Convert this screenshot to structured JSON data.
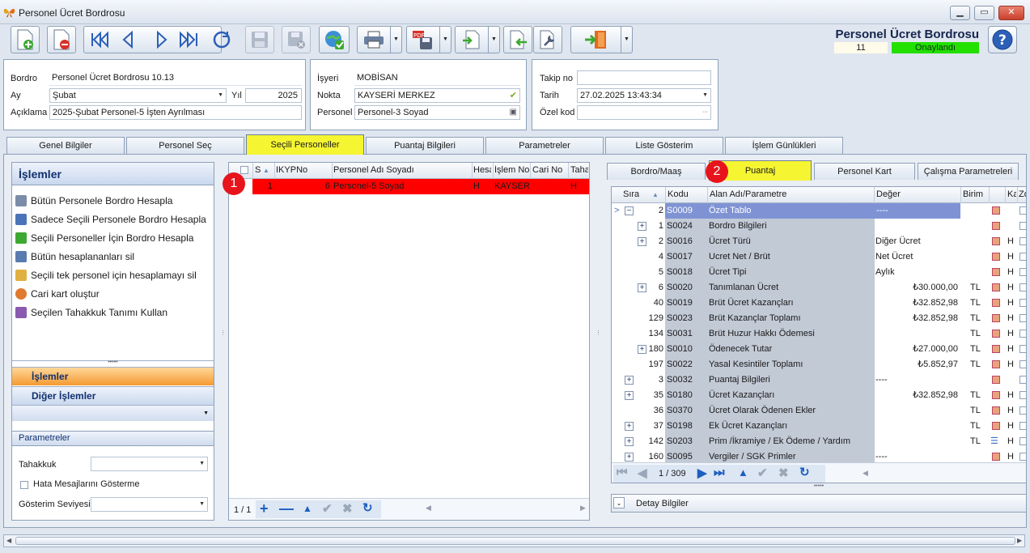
{
  "window": {
    "title": "Personel Ücret Bordrosu"
  },
  "header": {
    "doc_title": "Personel Ücret Bordrosu",
    "doc_no": "11",
    "status": "Onaylandı",
    "status_color": "#22e000"
  },
  "form": {
    "bordro_label": "Bordro",
    "bordro_value": "Personel Ücret Bordrosu 10.13",
    "ay_label": "Ay",
    "ay_value": "Şubat",
    "yil_label": "Yıl",
    "yil_value": "2025",
    "aciklama_label": "Açıklama",
    "aciklama_value": "2025-Şubat Personel-5 İşten Ayrılması",
    "isyeri_label": "İşyeri",
    "isyeri_value": "MOBİSAN",
    "nokta_label": "Nokta",
    "nokta_value": "KAYSERİ MERKEZ",
    "personel_label": "Personel",
    "personel_value": "Personel-3 Soyad",
    "takip_label": "Takip no",
    "takip_value": "",
    "tarih_label": "Tarih",
    "tarih_value": "27.02.2025 13:43:34",
    "ozel_label": "Özel kod",
    "ozel_value": "",
    "ellipsis": "···"
  },
  "tabs": [
    "Genel Bilgiler",
    "Personel Seç",
    "Seçili Personeller",
    "Puantaj Bilgileri",
    "Parametreler",
    "Liste Gösterim",
    "İşlem Günlükleri"
  ],
  "left": {
    "title": "İşlemler",
    "ops": [
      "Bütün Personele Bordro Hesapla",
      "Sadece Seçili Personele Bordro Hesapla",
      "Seçili Personeller İçin Bordro Hesapla",
      "Bütün hesaplananları sil",
      "Seçili tek personel için hesaplamayı sil",
      "Cari kart oluştur",
      "Seçilen Tahakkuk Tanımı Kullan"
    ],
    "nav_active": "İşlemler",
    "nav_other": "Diğer İşlemler",
    "params_title": "Parametreler",
    "tahakkuk_label": "Tahakkuk",
    "hata_label": "Hata Mesajlarını Gösterme",
    "seviye_label": "Gösterim Seviyesi"
  },
  "mid": {
    "columns": [
      "S",
      "IKYPNo",
      "Personel Adı Soyadı",
      "Hesa",
      "İşlem No",
      "Cari No",
      "Taha"
    ],
    "row": {
      "s": "1",
      "ikyp": "6",
      "name": "Personel-5 Soyad",
      "hesa": "H",
      "islem": "KAYSERİ",
      "cari": "",
      "taha": "H"
    },
    "row_color": "#ff0000",
    "pager": "1 / 1",
    "badge": "1"
  },
  "right": {
    "subtabs": [
      "Bordro/Maaş",
      "Puantaj",
      "Personel Kart",
      "Çalışma Parametreleri"
    ],
    "badge": "2",
    "columns": [
      "Sıra",
      "Kodu",
      "Alan Adı/Parametre",
      "Değer",
      "Birim",
      "Ka",
      "Zo"
    ],
    "rows": [
      {
        "sira": "2",
        "kod": "S0009",
        "ad": "Özet Tablo",
        "deger": "----",
        "birim": "",
        "h": "",
        "tree": "minus",
        "indent": 0
      },
      {
        "sira": "1",
        "kod": "S0024",
        "ad": "Bordro Bilgileri",
        "deger": "",
        "birim": "",
        "h": "",
        "tree": "plus",
        "indent": 1
      },
      {
        "sira": "2",
        "kod": "S0016",
        "ad": "Ücret Türü",
        "deger": "Diğer Ücret",
        "birim": "",
        "h": "H",
        "tree": "plus",
        "indent": 1
      },
      {
        "sira": "4",
        "kod": "S0017",
        "ad": "Ucret Net / Brüt",
        "deger": "Net Ücret",
        "birim": "",
        "h": "H",
        "tree": "",
        "indent": 1
      },
      {
        "sira": "5",
        "kod": "S0018",
        "ad": "Ücret Tipi",
        "deger": "Aylık",
        "birim": "",
        "h": "H",
        "tree": "",
        "indent": 1
      },
      {
        "sira": "6",
        "kod": "S0020",
        "ad": "Tanımlanan Ücret",
        "deger": "₺30.000,00",
        "birim": "TL",
        "h": "H",
        "tree": "plus",
        "indent": 1
      },
      {
        "sira": "40",
        "kod": "S0019",
        "ad": "Brüt Ücret Kazançları",
        "deger": "₺32.852,98",
        "birim": "TL",
        "h": "H",
        "tree": "",
        "indent": 1
      },
      {
        "sira": "129",
        "kod": "S0023",
        "ad": "Brüt Kazançlar Toplamı",
        "deger": "₺32.852,98",
        "birim": "TL",
        "h": "H",
        "tree": "",
        "indent": 1
      },
      {
        "sira": "134",
        "kod": "S0031",
        "ad": "Brüt Huzur Hakkı Ödemesi",
        "deger": "",
        "birim": "TL",
        "h": "H",
        "tree": "",
        "indent": 1
      },
      {
        "sira": "180",
        "kod": "S0010",
        "ad": "Ödenecek Tutar",
        "deger": "₺27.000,00",
        "birim": "TL",
        "h": "H",
        "tree": "plus",
        "indent": 1
      },
      {
        "sira": "197",
        "kod": "S0022",
        "ad": "Yasal Kesintiler Toplamı",
        "deger": "₺5.852,97",
        "birim": "TL",
        "h": "H",
        "tree": "",
        "indent": 1
      },
      {
        "sira": "3",
        "kod": "S0032",
        "ad": "Puantaj Bilgileri",
        "deger": "----",
        "birim": "",
        "h": "",
        "tree": "plus",
        "indent": 0
      },
      {
        "sira": "35",
        "kod": "S0180",
        "ad": "Ücret Kazançları",
        "deger": "₺32.852,98",
        "birim": "TL",
        "h": "H",
        "tree": "plus",
        "indent": 0
      },
      {
        "sira": "36",
        "kod": "S0370",
        "ad": "Ücret Olarak Ödenen Ekler",
        "deger": "",
        "birim": "TL",
        "h": "H",
        "tree": "",
        "indent": 0
      },
      {
        "sira": "37",
        "kod": "S0198",
        "ad": "Ek Ücret Kazançları",
        "deger": "",
        "birim": "TL",
        "h": "H",
        "tree": "plus",
        "indent": 0
      },
      {
        "sira": "142",
        "kod": "S0203",
        "ad": "Prim /İkramiye / Ek Ödeme / Yardım",
        "deger": "",
        "birim": "TL",
        "h": "H",
        "tree": "plus",
        "indent": 0
      },
      {
        "sira": "160",
        "kod": "S0095",
        "ad": "Vergiler / SGK Primler",
        "deger": "----",
        "birim": "",
        "h": "H",
        "tree": "plus",
        "indent": 0
      }
    ],
    "pager": "1 / 309",
    "detay": "Detay Bilgiler"
  }
}
